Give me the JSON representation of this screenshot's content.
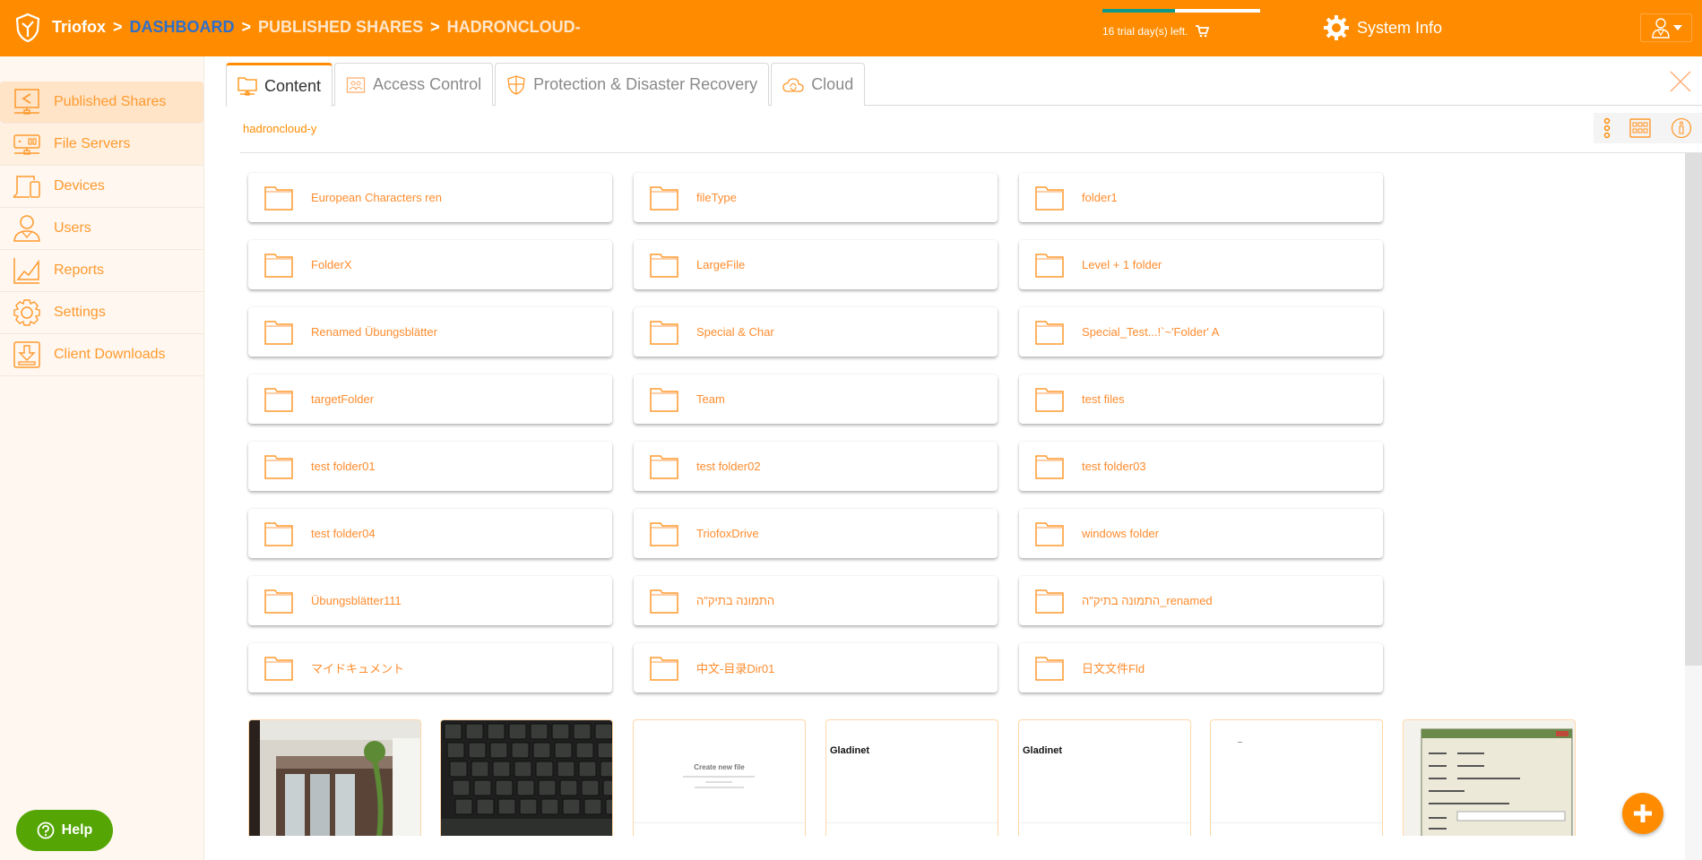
{
  "header": {
    "brand": "Triofox",
    "separator": ">",
    "breadcrumb": [
      "DASHBOARD",
      "PUBLISHED SHARES",
      "HADRONCLOUD-"
    ],
    "trial_text": "16 trial day(s) left.",
    "trial_progress": 0.46,
    "system_info_label": "System Info",
    "colors": {
      "brand": "#FF8C00",
      "link": "#2F6FC9",
      "trial_bar": "#0E9A8A"
    }
  },
  "sidebar": {
    "items": [
      {
        "label": "Published Shares",
        "icon": "published-shares-icon",
        "active": true
      },
      {
        "label": "File Servers",
        "icon": "file-servers-icon"
      },
      {
        "label": "Devices",
        "icon": "devices-icon"
      },
      {
        "label": "Users",
        "icon": "users-icon"
      },
      {
        "label": "Reports",
        "icon": "reports-icon"
      },
      {
        "label": "Settings",
        "icon": "settings-icon"
      },
      {
        "label": "Client Downloads",
        "icon": "client-downloads-icon"
      }
    ],
    "help_label": "Help"
  },
  "tabs": [
    {
      "label": "Content",
      "active": true
    },
    {
      "label": "Access Control"
    },
    {
      "label": "Protection & Disaster Recovery"
    },
    {
      "label": "Cloud"
    }
  ],
  "path_label": "hadroncloud-y",
  "folders": [
    "European Characters ren",
    "fileType",
    "folder1",
    "FolderX",
    "LargeFile",
    "Level + 1 folder",
    "Renamed Übungsblätter",
    "Special & Char",
    "Special_Test...!`~'Folder' A",
    "targetFolder",
    " Team",
    "test files",
    "test folder01",
    "test folder02",
    "test folder03",
    "test folder04",
    "TriofoxDrive",
    "windows folder",
    "Übungsblätter111",
    "התמונה בתיק\"ה",
    "התמונה בתיק\"ה_renamed",
    "マイドキュメント",
    "中文-目录Dir01",
    "日文文件Fld"
  ],
  "thumbnails": [
    {
      "kind": "photo-room"
    },
    {
      "kind": "photo-keyboard"
    },
    {
      "kind": "document",
      "title": "Create new file"
    },
    {
      "kind": "document",
      "title": "Gladinet"
    },
    {
      "kind": "document",
      "title": "Gladinet"
    },
    {
      "kind": "document",
      "title": ""
    },
    {
      "kind": "screenshot-dialog"
    }
  ]
}
